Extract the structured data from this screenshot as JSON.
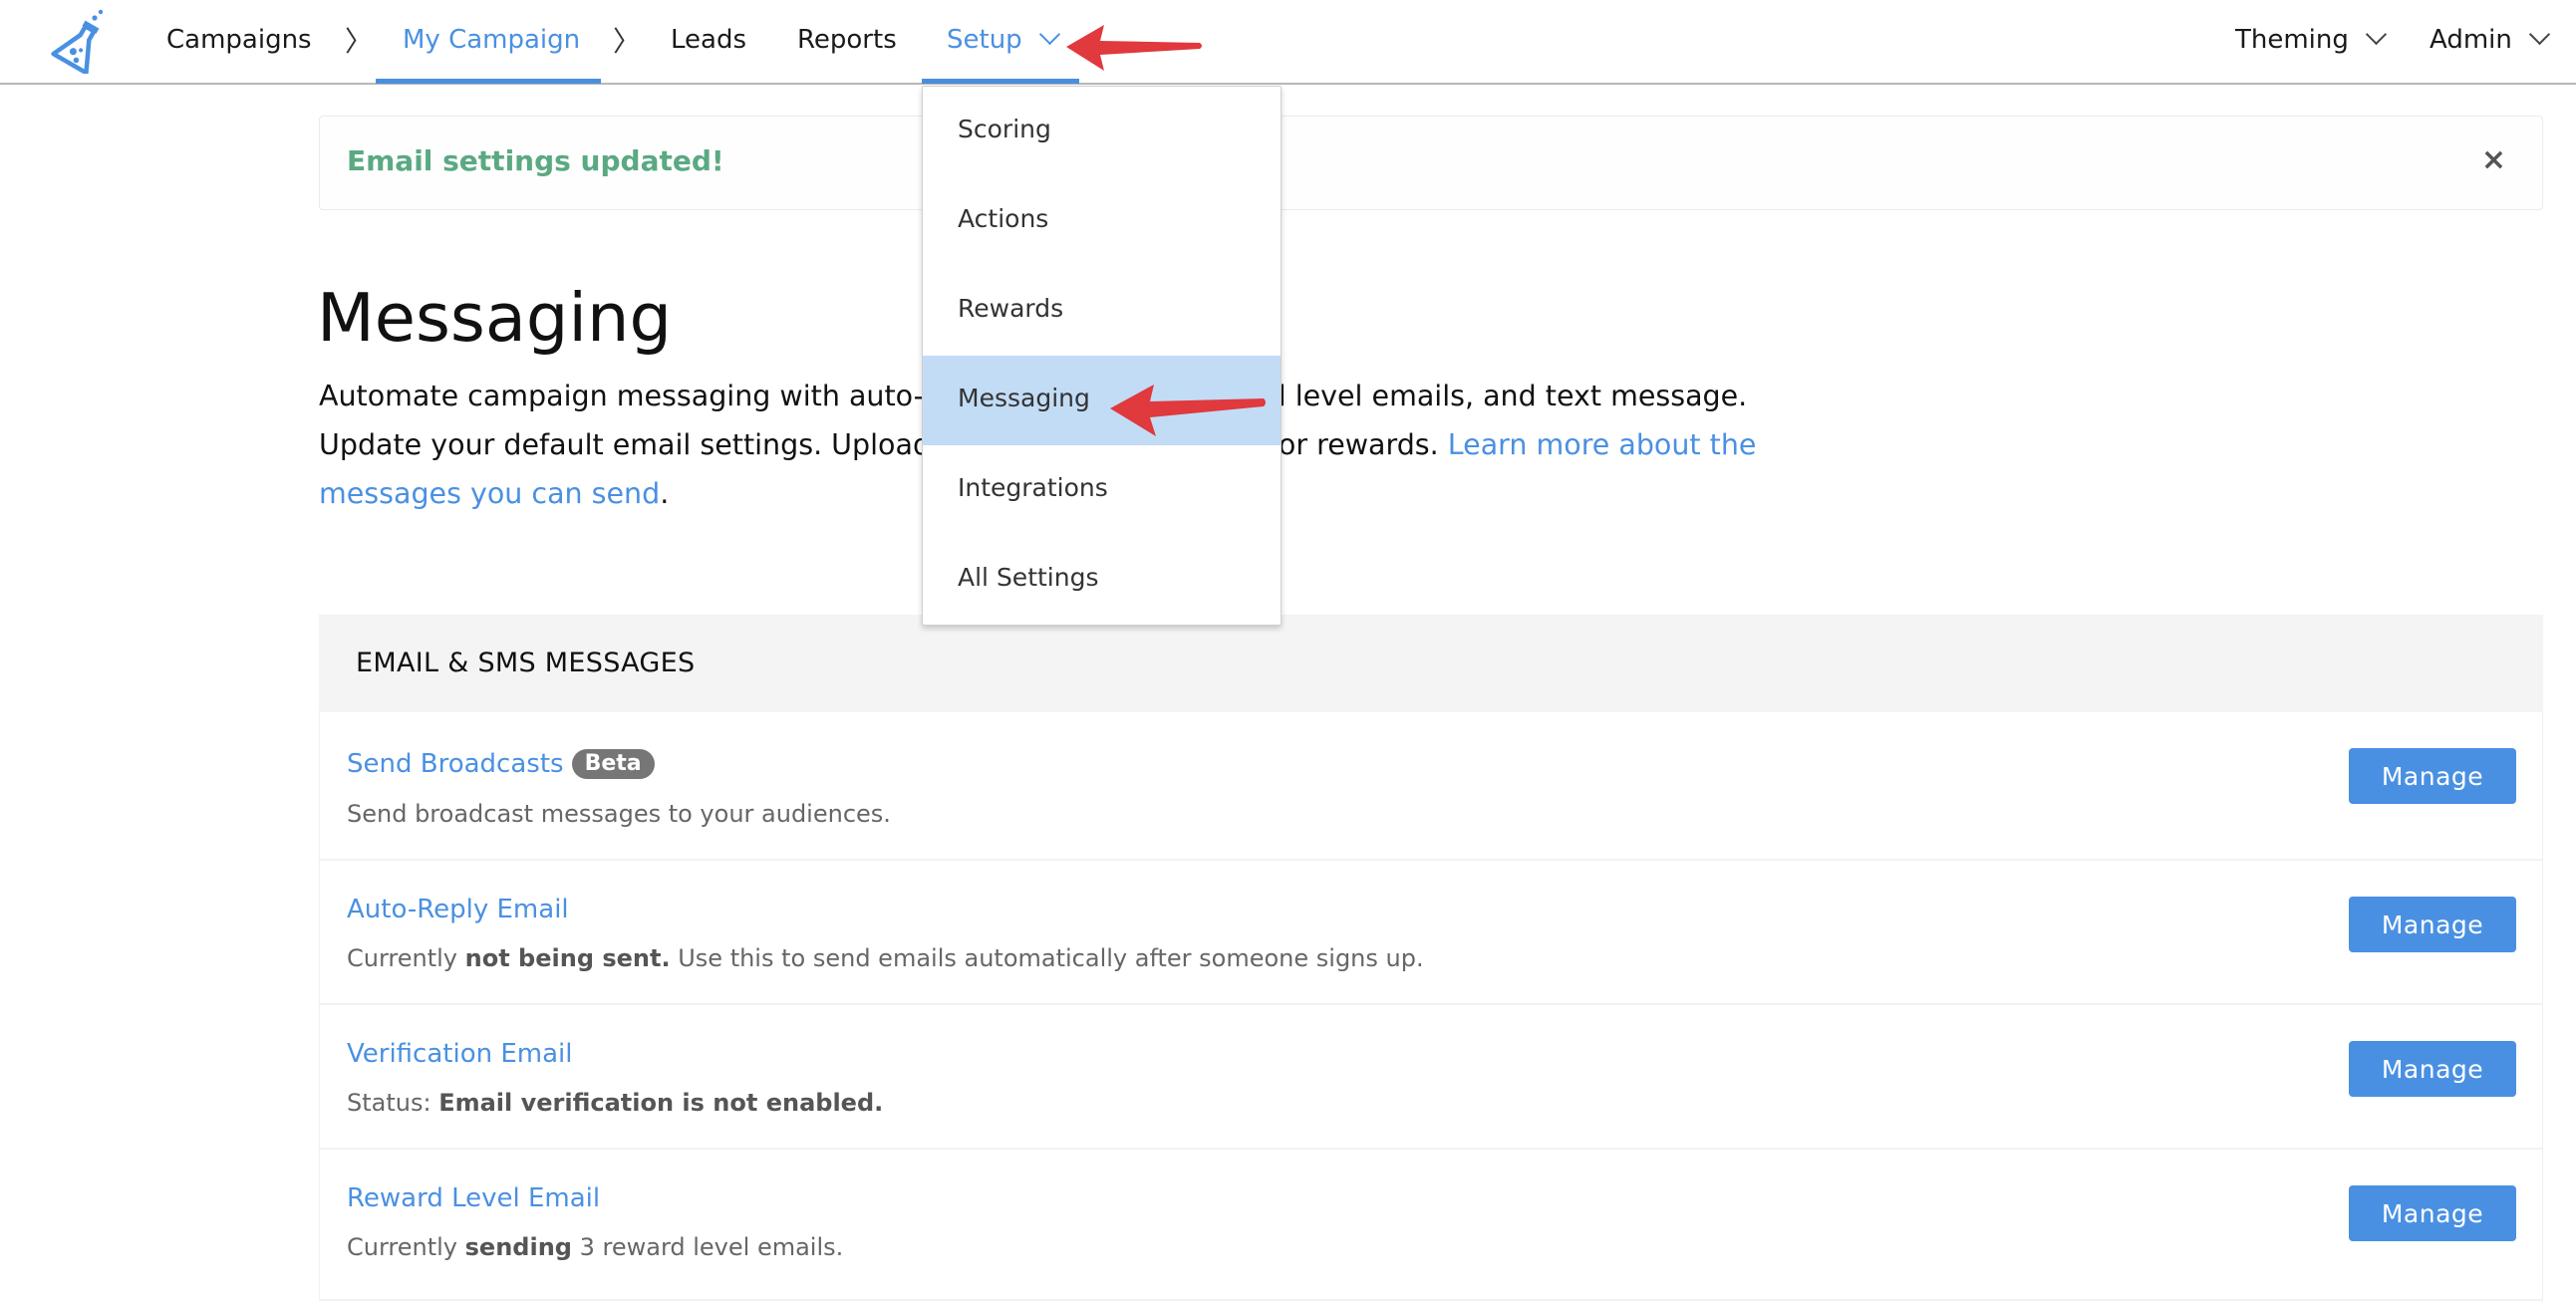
{
  "navbar": {
    "logo": "flask-logo",
    "breadcrumbs": [
      {
        "label": "Campaigns"
      },
      {
        "label": "My Campaign",
        "active": true
      },
      {
        "label": "Leads"
      },
      {
        "label": "Reports"
      }
    ],
    "setup_label": "Setup",
    "right_menus": [
      {
        "label": "Theming"
      },
      {
        "label": "Admin"
      }
    ]
  },
  "alert": {
    "message": "Email settings updated!",
    "close_icon": "×",
    "color": "#5aa982"
  },
  "setup_dropdown": {
    "items": [
      {
        "label": "Scoring"
      },
      {
        "label": "Actions"
      },
      {
        "label": "Rewards"
      },
      {
        "label": "Messaging",
        "highlighted": true
      },
      {
        "label": "Integrations"
      },
      {
        "label": "All Settings"
      }
    ]
  },
  "page": {
    "title": "Messaging",
    "description_start": "Automate campaign messaging with auto-responder emails, reward level emails, and text message. Update your default email settings. Upload unique discount codes for rewards. ",
    "description_link": "Learn more about the messages you can send",
    "description_end": "."
  },
  "section": {
    "title": "EMAIL & SMS MESSAGES",
    "rows": [
      {
        "title": "Send Broadcasts",
        "badge": "Beta",
        "desc_pre": "Send broadcast messages to your audiences.",
        "desc_bold": "",
        "desc_post": "",
        "button": "Manage"
      },
      {
        "title": "Auto-Reply Email",
        "desc_pre": "Currently ",
        "desc_bold": "not being sent.",
        "desc_post": " Use this to send emails automatically after someone signs up.",
        "button": "Manage"
      },
      {
        "title": "Verification Email",
        "desc_pre": "Status: ",
        "desc_bold": "Email verification is not enabled.",
        "desc_post": "",
        "button": "Manage"
      },
      {
        "title": "Reward Level Email",
        "desc_pre": "Currently ",
        "desc_bold": "sending",
        "desc_post": " 3 reward level emails.",
        "button": "Manage"
      }
    ]
  },
  "colors": {
    "accent": "#4a90e2",
    "highlight": "#c2dcf6",
    "annotation_arrow": "#e0393e",
    "badge": "#767676"
  }
}
